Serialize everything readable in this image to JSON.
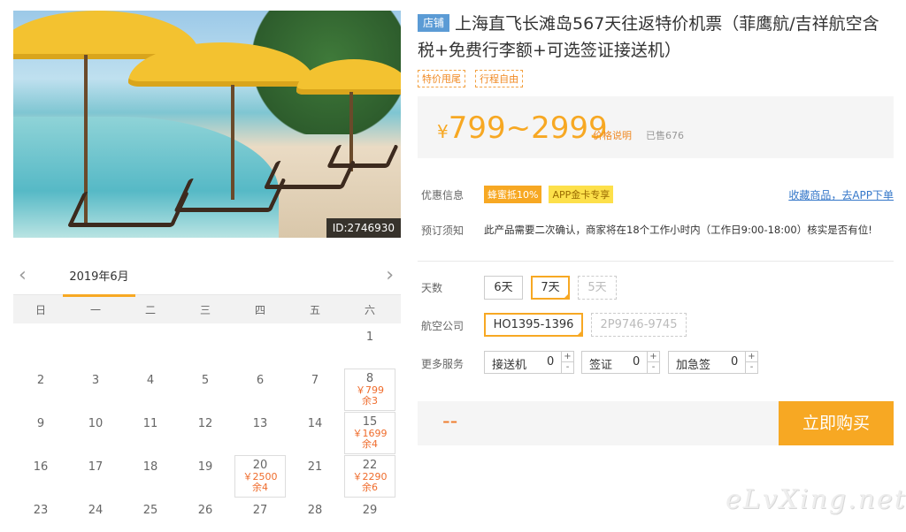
{
  "photo": {
    "id_label": "ID:2746930"
  },
  "calendar": {
    "prev": "‹",
    "next": "›",
    "month": "2019年6月",
    "weekdays": [
      "日",
      "一",
      "二",
      "三",
      "四",
      "五",
      "六"
    ],
    "days": [
      {
        "n": "1"
      },
      {
        "n": "2"
      },
      {
        "n": "3"
      },
      {
        "n": "4"
      },
      {
        "n": "5"
      },
      {
        "n": "6"
      },
      {
        "n": "7"
      },
      {
        "n": "8",
        "price": "￥799",
        "remain": "余3"
      },
      {
        "n": "9"
      },
      {
        "n": "10"
      },
      {
        "n": "11"
      },
      {
        "n": "12"
      },
      {
        "n": "13"
      },
      {
        "n": "14"
      },
      {
        "n": "15",
        "price": "￥1699",
        "remain": "余4"
      },
      {
        "n": "16"
      },
      {
        "n": "17"
      },
      {
        "n": "18"
      },
      {
        "n": "19"
      },
      {
        "n": "20",
        "price": "￥2500",
        "remain": "余4"
      },
      {
        "n": "21"
      },
      {
        "n": "22",
        "price": "￥2290",
        "remain": "余6"
      },
      {
        "n": "23"
      },
      {
        "n": "24"
      },
      {
        "n": "25"
      },
      {
        "n": "26"
      },
      {
        "n": "27"
      },
      {
        "n": "28"
      },
      {
        "n": "29"
      }
    ]
  },
  "product": {
    "shop_tag": "店铺",
    "title": "上海直飞长滩岛567天往返特价机票（菲鹰航/吉祥航空含税+免费行李额+可选签证接送机）",
    "tags": [
      "特价甩尾",
      "行程自由"
    ],
    "price_currency": "¥",
    "price_range": "799~2999",
    "price_note": "价格说明",
    "sold": "已售676"
  },
  "info": {
    "discount_label": "优惠信息",
    "discounts": [
      "蜂蜜抵10%",
      "APP金卡专享"
    ],
    "fav_link": "收藏商品，去APP下单",
    "notice_label": "预订须知",
    "notice": "此产品需要二次确认，商家将在18个工作小时内（工作日9:00-18:00）核实是否有位!"
  },
  "options": {
    "days_label": "天数",
    "days": [
      "6天",
      "7天",
      "5天"
    ],
    "airline_label": "航空公司",
    "airlines": [
      "HO1395-1396",
      "2P9746-9745"
    ],
    "services_label": "更多服务",
    "services": [
      {
        "name": "接送机",
        "qty": "0"
      },
      {
        "name": "签证",
        "qty": "0"
      },
      {
        "name": "加急签",
        "qty": "0"
      }
    ],
    "plus": "+",
    "minus": "-"
  },
  "buy": {
    "total": "--",
    "button": "立即购买"
  },
  "watermark": "eLvXing.net"
}
